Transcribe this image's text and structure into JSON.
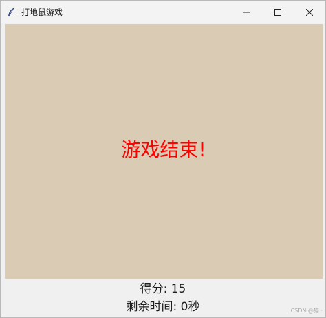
{
  "window": {
    "title": "打地鼠游戏",
    "app_icon": "feather-icon",
    "controls": {
      "minimize": "minimize-icon",
      "maximize": "maximize-icon",
      "close": "close-icon"
    }
  },
  "game": {
    "message": "游戏结束!",
    "message_color": "#ff0000",
    "background_color": "#d9cbb4"
  },
  "status": {
    "score": "得分: 15",
    "time_left": "剩余时间: 0秒"
  },
  "watermark": "CSDN @猫 ·"
}
